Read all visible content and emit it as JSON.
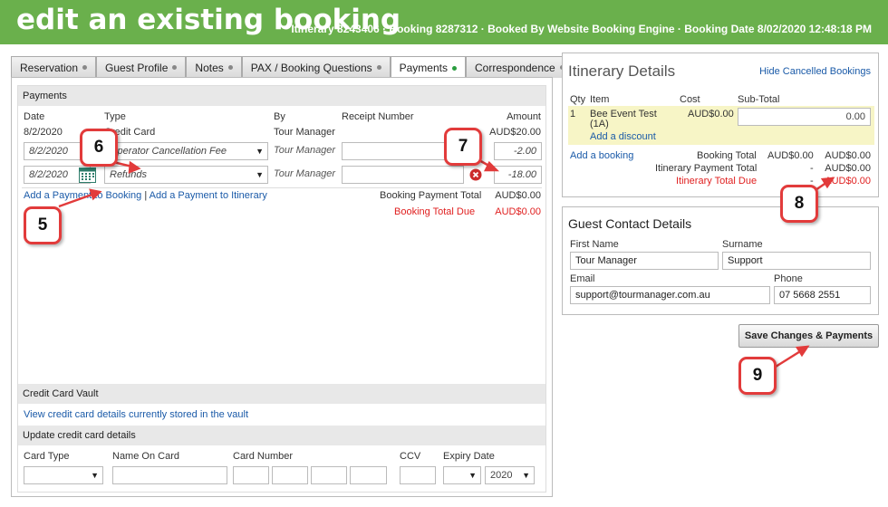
{
  "header": {
    "title": "edit an existing booking",
    "info": "Itinerary 8243406 · Booking 8287312 · Booked By Website Booking Engine · Booking Date 8/02/2020 12:48:18 PM"
  },
  "tabs": [
    {
      "label": "Reservation"
    },
    {
      "label": "Guest Profile"
    },
    {
      "label": "Notes"
    },
    {
      "label": "PAX / Booking Questions"
    },
    {
      "label": "Payments"
    },
    {
      "label": "Correspondence"
    }
  ],
  "payments": {
    "section_title": "Payments",
    "columns": {
      "date": "Date",
      "type": "Type",
      "by": "By",
      "receipt": "Receipt Number",
      "amount": "Amount"
    },
    "rows": [
      {
        "date": "8/2/2020",
        "type": "Credit Card",
        "by": "Tour Manager",
        "amount": "AUD$20.00"
      },
      {
        "date": "8/2/2020",
        "type": "Operator Cancellation Fee",
        "by": "Tour Manager",
        "receipt": "",
        "amount": "-2.00"
      },
      {
        "date": "8/2/2020",
        "type": "Refunds",
        "by": "Tour Manager",
        "receipt": "",
        "amount": "-18.00"
      }
    ],
    "add_payment_booking": "Add a Payment to Booking",
    "separator": "|",
    "add_payment_itinerary": "Add a Payment to Itinerary",
    "booking_payment_total_label": "Booking Payment Total",
    "booking_payment_total": "AUD$0.00",
    "booking_total_due_label": "Booking Total Due",
    "booking_total_due": "AUD$0.00"
  },
  "vault": {
    "section_title": "Credit Card Vault",
    "link": "View credit card details currently stored in the vault"
  },
  "update_cc": {
    "section_title": "Update credit card details",
    "card_type_label": "Card Type",
    "name_label": "Name On Card",
    "number_label": "Card Number",
    "ccv_label": "CCV",
    "expiry_label": "Expiry Date",
    "expiry_year": "2020"
  },
  "itinerary": {
    "title": "Itinerary Details",
    "hide_link": "Hide Cancelled Bookings",
    "columns": {
      "qty": "Qty",
      "item": "Item",
      "cost": "Cost",
      "subtotal": "Sub-Total"
    },
    "item": {
      "qty": "1",
      "name": "Bee Event Test",
      "code": "(1A)",
      "cost": "AUD$0.00",
      "subtotal": "0.00"
    },
    "add_discount": "Add a discount",
    "add_booking": "Add a booking",
    "booking_total_label": "Booking Total",
    "booking_total_a": "AUD$0.00",
    "booking_total_b": "AUD$0.00",
    "payment_total_label": "Itinerary Payment Total",
    "payment_total_dash": "-",
    "payment_total": "AUD$0.00",
    "total_due_label": "Itinerary Total Due",
    "total_due_dash": "-",
    "total_due": "AUD$0.00"
  },
  "guest": {
    "title": "Guest Contact Details",
    "first_name_label": "First Name",
    "first_name": "Tour Manager",
    "surname_label": "Surname",
    "surname": "Support",
    "email_label": "Email",
    "email": "support@tourmanager.com.au",
    "phone_label": "Phone",
    "phone": "07 5668 2551"
  },
  "save_button": "Save Changes & Payments",
  "callouts": {
    "c5": "5",
    "c6": "6",
    "c7": "7",
    "c8": "8",
    "c9": "9"
  },
  "colors": {
    "header": "#6ab04c",
    "link": "#1a5aa8",
    "due": "#e02020",
    "callout_border": "#e23b3b",
    "itinerary_highlight": "#f7f5c6"
  }
}
